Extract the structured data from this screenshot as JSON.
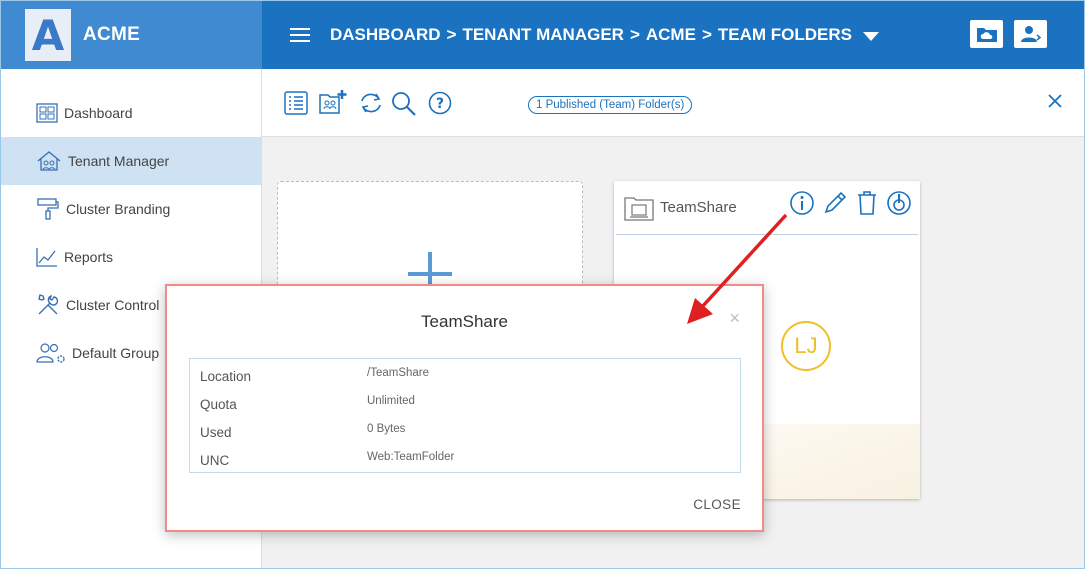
{
  "app": {
    "logo_letter": "A",
    "brand_name": "ACME"
  },
  "header": {
    "breadcrumb": [
      "DASHBOARD",
      ">",
      "TENANT MANAGER",
      ">",
      "ACME",
      ">",
      "TEAM FOLDERS"
    ]
  },
  "sidebar": {
    "items": [
      {
        "label": "Dashboard",
        "icon": "dashboard-grid-icon"
      },
      {
        "label": "Tenant Manager",
        "icon": "tenant-house-icon",
        "active": true
      },
      {
        "label": "Cluster Branding",
        "icon": "paint-roller-icon"
      },
      {
        "label": "Reports",
        "icon": "line-chart-icon"
      },
      {
        "label": "Cluster Control",
        "icon": "wrench-screwdriver-icon"
      },
      {
        "label": "Default Group",
        "icon": "user-group-gear-icon"
      }
    ]
  },
  "toolbar": {
    "status_pill": "1 Published (Team) Folder(s)"
  },
  "folder_card": {
    "title": "TeamShare",
    "owner_initials": "LJ"
  },
  "modal": {
    "title": "TeamShare",
    "close_glyph": "×",
    "rows": [
      {
        "label": "Location",
        "value": "/TeamShare"
      },
      {
        "label": "Quota",
        "value": "Unlimited"
      },
      {
        "label": "Used",
        "value": "0 Bytes"
      },
      {
        "label": "UNC",
        "value": "Web:TeamFolder"
      }
    ],
    "close_button": "CLOSE"
  },
  "colors": {
    "header_blue": "#1b72c0",
    "brand_blue": "#3f8ad0",
    "sidebar_active": "#cfe2f3",
    "avatar_yellow": "#f0be25",
    "annotation_red": "#e02020"
  }
}
